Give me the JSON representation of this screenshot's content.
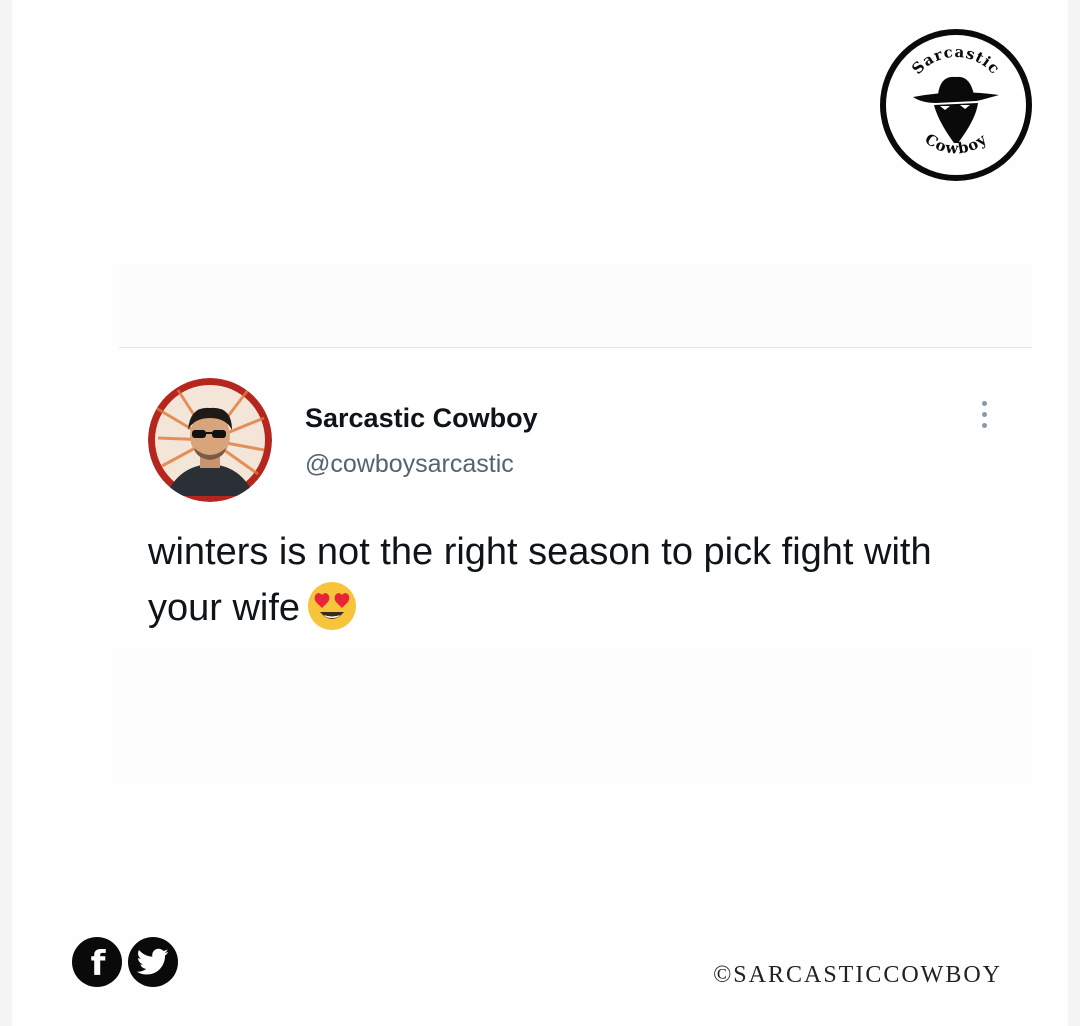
{
  "brand": {
    "logo_top_text": "Sarcastic",
    "logo_bottom_text": "Cowboy",
    "copyright": "©SARCASTICCOWBOY"
  },
  "tweet": {
    "display_name": "Sarcastic Cowboy",
    "handle": "@cowboysarcastic",
    "text": "winters is not the right season to pick fight with your wife",
    "emoji": "smiling-face-with-heart-eyes"
  },
  "footer": {
    "social_icons": [
      "facebook-icon",
      "twitter-icon"
    ]
  },
  "colors": {
    "name": "#0f1419",
    "handle": "#536471",
    "avatar_ring": "#b5261e",
    "divider": "#dfe7ec"
  }
}
